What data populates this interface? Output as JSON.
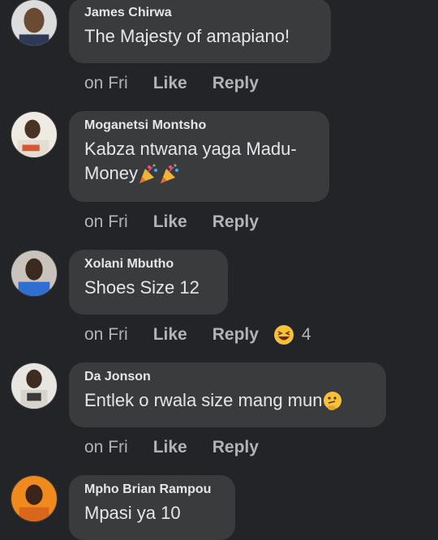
{
  "comments": [
    {
      "author": "James Chirwa",
      "text": "The Majesty of amapiano!",
      "time": "on Fri",
      "like": "Like",
      "reply": "Reply"
    },
    {
      "author": "Moganetsi Montsho",
      "text_line1": "Kabza ntwana yaga Madu-",
      "text_line2": "Money",
      "emojis": [
        "party-popper-icon",
        "party-popper-icon"
      ],
      "time": "on Fri",
      "like": "Like",
      "reply": "Reply"
    },
    {
      "author": "Xolani Mbutho",
      "text": "Shoes Size 12",
      "time": "on Fri",
      "like": "Like",
      "reply": "Reply",
      "reaction": {
        "icon": "laughing-face-icon",
        "count": "4"
      }
    },
    {
      "author": "Da Jonson",
      "text": "Entlek o rwala size mang mun",
      "emoji": "thinking-face-icon",
      "time": "on Fri",
      "like": "Like",
      "reply": "Reply"
    },
    {
      "author": "Mpho Brian Rampou",
      "text": "Mpasi ya 10"
    }
  ],
  "colors": {
    "background": "#232427",
    "bubble": "#3a3b3c",
    "primary_text": "#e4e6eb",
    "secondary_text": "#b0b3b8",
    "reaction_yellow": "#f7c23a"
  }
}
